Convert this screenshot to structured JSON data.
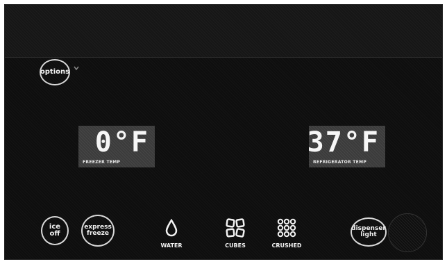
{
  "options": {
    "label": "options"
  },
  "freezer": {
    "value": "0°F",
    "label": "FREEZER TEMP"
  },
  "refrigerator": {
    "value": "37°F",
    "label": "REFRIGERATOR TEMP"
  },
  "buttons": {
    "ice_off": [
      "ice",
      "off"
    ],
    "express_freeze": [
      "express",
      "freeze"
    ],
    "dispenser_light": [
      "dispenser",
      "light"
    ]
  },
  "dispenser": {
    "water": "WATER",
    "cubes": "CUBES",
    "crushed": "CRUSHED"
  },
  "colors": {
    "panel": "#0e0e0e",
    "display": "#3b3b3b",
    "text": "#f2f2f2"
  },
  "icons": [
    "chevron-down-icon",
    "water-drop-icon",
    "ice-cubes-icon",
    "crushed-ice-icon"
  ]
}
